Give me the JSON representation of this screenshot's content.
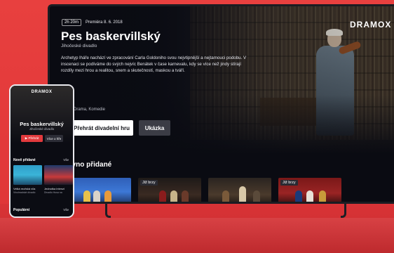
{
  "tv": {
    "brand": "DRAMOX",
    "duration": "2h 20m",
    "premiere": "Premiéra 8. 6. 2018",
    "title": "Pes baskervillský",
    "subtitle": "Jihočeské divadlo",
    "description": "Archetyp lháře nachází ve zpracování Carla Goldoniho svou nejvtipnější a nejtamouci podobu. V inscenaci se podíváme do svých nejvíc Benátek v čase karnevalu, kdy se více než jindy stírají rozdíly mezi hrou a realitou, snem a skutečností, maskou a tváří.",
    "genres": "Drama, Komedie",
    "play_label": "Přehrát divadelní hru",
    "trailer_label": "Ukázka",
    "section_title": "ávno přidané",
    "cards": [
      {
        "tag": ""
      },
      {
        "tag": "Již brzy"
      },
      {
        "tag": ""
      },
      {
        "tag": "Již brzy"
      }
    ]
  },
  "phone": {
    "brand": "DRAMOX",
    "title": "Pes baskervillský",
    "subtitle": "Jihočeské divadlo",
    "play_label": "▶ Přehrát",
    "info_label": "Více o hře",
    "new_section": "Nově přidané",
    "new_more": "Vše",
    "card1_title": "Velká mořská víla",
    "card1_sub": "Vinohradské divadlo",
    "card2_title": "Jednotka intenzi",
    "card2_sub": "Divadlo Husa na",
    "popular_section": "Populární",
    "popular_more": "Vše"
  },
  "colors": {
    "background": "#e23a3d",
    "accent": "#e23a3d",
    "screen": "#0a0b12"
  }
}
